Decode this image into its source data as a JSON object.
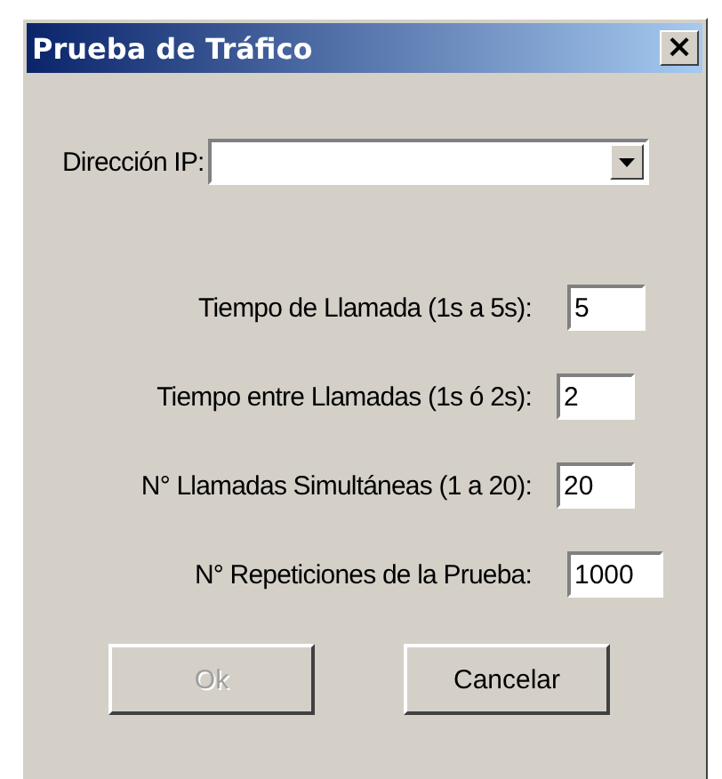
{
  "window": {
    "title": "Prueba de Tráfico",
    "close": "×"
  },
  "ip": {
    "label": "Dirección IP:"
  },
  "fields": [
    {
      "label": "Tiempo de Llamada (1s a 5s):",
      "value": "5"
    },
    {
      "label": "Tiempo entre Llamadas (1s ó 2s):",
      "value": "2"
    },
    {
      "label": "N° Llamadas Simultáneas (1 a 20):",
      "value": "20"
    },
    {
      "label": "N° Repeticiones de la Prueba:",
      "value": "1000"
    }
  ],
  "buttons": [
    {
      "label": "Ok",
      "disabled": true
    },
    {
      "label": "Cancelar",
      "disabled": false
    }
  ]
}
